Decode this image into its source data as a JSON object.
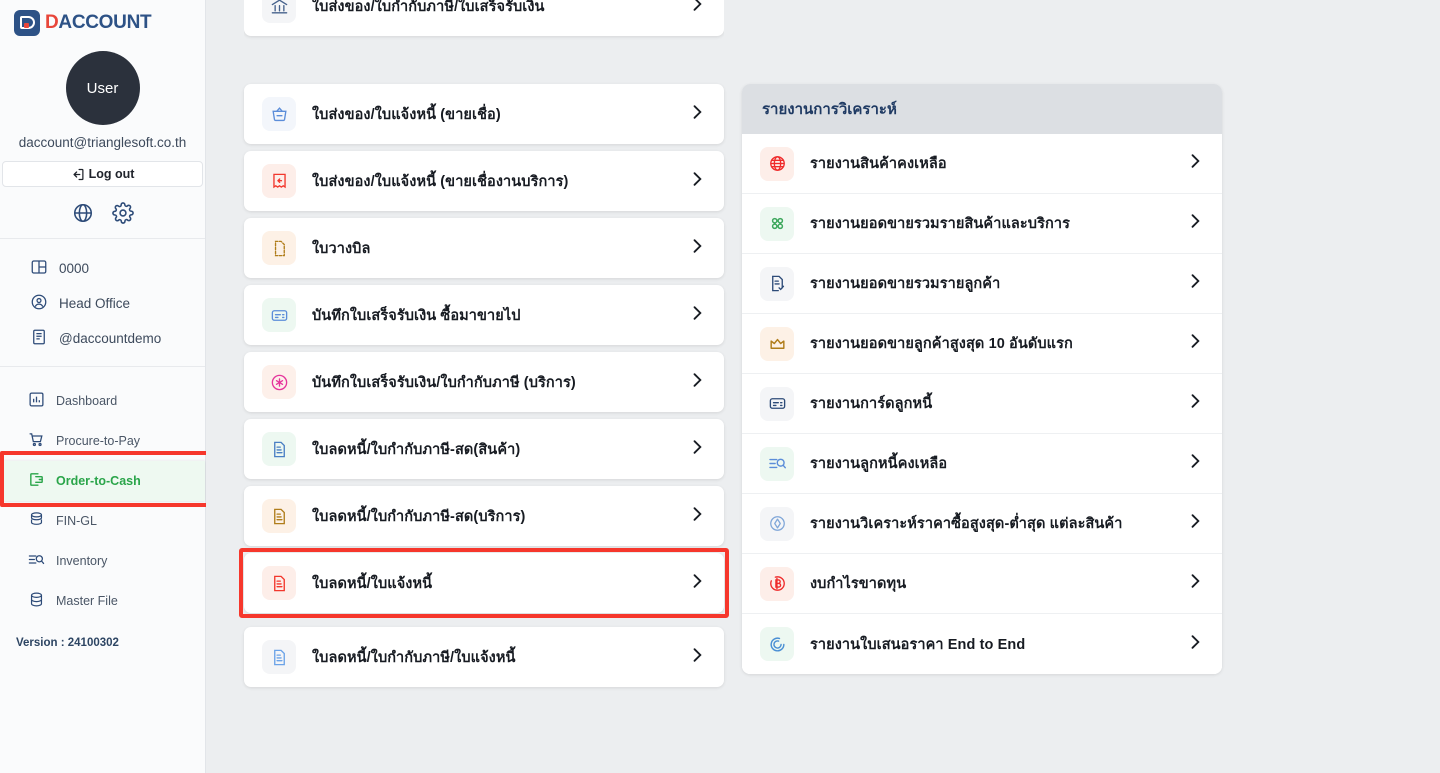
{
  "brand": {
    "name_prefix": "D",
    "name": "ACCOUNT",
    "logo_icon": "daccount-logo-icon"
  },
  "sidebar": {
    "avatar_label": "User",
    "email": "daccount@trianglesoft.co.th",
    "logout_label": "Log out",
    "quick_icons": [
      {
        "name": "globe-icon",
        "label": "Language"
      },
      {
        "name": "gear-icon",
        "label": "Settings"
      }
    ],
    "org_items": [
      {
        "icon": "company-icon",
        "label": "0000"
      },
      {
        "icon": "user-circle-icon",
        "label": "Head Office"
      },
      {
        "icon": "document-icon",
        "label": "@daccountdemo"
      }
    ],
    "nav_items": [
      {
        "icon": "dashboard-icon",
        "label": "Dashboard",
        "active": false
      },
      {
        "icon": "cart-icon",
        "label": "Procure-to-Pay",
        "active": false
      },
      {
        "icon": "order-to-cash-icon",
        "label": "Order-to-Cash",
        "active": true
      },
      {
        "icon": "coins-icon",
        "label": "FIN-GL",
        "active": false
      },
      {
        "icon": "inventory-search-icon",
        "label": "Inventory",
        "active": false
      },
      {
        "icon": "database-icon",
        "label": "Master File",
        "active": false
      }
    ],
    "version_label": "Version : 24100302",
    "highlight_target": "Order-to-Cash",
    "accent_active": "#2aa54a",
    "highlight_color": "#f6372c"
  },
  "documents_panel": {
    "items": [
      {
        "icon": "bank-icon",
        "label": "ใบส่งของ/ใบกำกับภาษี/ใบเสร็จรับเงิน",
        "icon_color": "#46628c",
        "icon_bg": "#f4f5f7",
        "highlighted": false
      },
      {
        "icon": "basket-icon",
        "label": "ใบส่งของ/ใบแจ้งหนี้ (ขายเชื่อ)",
        "icon_color": "#5b8dd9",
        "icon_bg": "#f3f6fb",
        "highlighted": false
      },
      {
        "icon": "receipt-return-icon",
        "label": "ใบส่งของ/ใบแจ้งหนี้ (ขายเชื่องานบริการ)",
        "icon_color": "#f2372c",
        "icon_bg": "#fdeee9",
        "highlighted": false
      },
      {
        "icon": "bill-icon",
        "label": "ใบวางบิล",
        "icon_color": "#b07d1a",
        "icon_bg": "#fdf1e6",
        "highlighted": false
      },
      {
        "icon": "card-note-icon",
        "label": "บันทึกใบเสร็จรับเงิน ซื้อมาขายไป",
        "icon_color": "#5b8dd9",
        "icon_bg": "#edf8f1",
        "highlighted": false
      },
      {
        "icon": "asterisk-circle-icon",
        "label": "บันทึกใบเสร็จรับเงิน/ใบกำกับภาษี (บริการ)",
        "icon_color": "#e5359c",
        "icon_bg": "#fdf0ea",
        "highlighted": false
      },
      {
        "icon": "credit-note-icon",
        "label": "ใบลดหนี้/ใบกำกับภาษี-สด(สินค้า)",
        "icon_color": "#4a7fc4",
        "icon_bg": "#edf8f1",
        "highlighted": false
      },
      {
        "icon": "credit-note-icon",
        "label": "ใบลดหนี้/ใบกำกับภาษี-สด(บริการ)",
        "icon_color": "#b07d1a",
        "icon_bg": "#fdf1e6",
        "highlighted": false
      },
      {
        "icon": "credit-note-icon",
        "label": "ใบลดหนี้/ใบแจ้งหนี้",
        "icon_color": "#f2372c",
        "icon_bg": "#fdeee9",
        "highlighted": true
      },
      {
        "icon": "credit-note-icon",
        "label": "ใบลดหนี้/ใบกำกับภาษี/ใบแจ้งหนี้",
        "icon_color": "#6ba3e8",
        "icon_bg": "#f4f5f7",
        "highlighted": false
      }
    ]
  },
  "reports_panel": {
    "header": "รายงานการวิเคราะห์",
    "items": [
      {
        "icon": "globe-report-icon",
        "label": "รายงานสินค้าคงเหลือ",
        "icon_color": "#ef2b2b",
        "icon_bg": "#fdeee9"
      },
      {
        "icon": "grid-dots-icon",
        "label": "รายงานยอดขายรวมรายสินค้าและบริการ",
        "icon_color": "#3fa85e",
        "icon_bg": "#edf8f1"
      },
      {
        "icon": "doc-check-icon",
        "label": "รายงานยอดขายรวมรายลูกค้า",
        "icon_color": "#2d4b78",
        "icon_bg": "#f4f5f7"
      },
      {
        "icon": "crown-icon",
        "label": "รายงานยอดขายลูกค้าสูงสุด 10 อันดับแรก",
        "icon_color": "#b07d1a",
        "icon_bg": "#fdf1e6"
      },
      {
        "icon": "card-note-icon",
        "label": "รายงานการ์ดลูกหนี้",
        "icon_color": "#2d4b78",
        "icon_bg": "#f4f5f7"
      },
      {
        "icon": "list-search-icon",
        "label": "รายงานลูกหนี้คงเหลือ",
        "icon_color": "#5b8dd9",
        "icon_bg": "#edf8f1"
      },
      {
        "icon": "price-analysis-icon",
        "label": "รายงานวิเคราะห์ราคาซื้อสูงสุด-ต่ำสุด แต่ละสินค้า",
        "icon_color": "#7fa6d8",
        "icon_bg": "#f4f5f7"
      },
      {
        "icon": "baht-circle-icon",
        "label": "งบกำไรขาดทุน",
        "icon_color": "#ef2b2b",
        "icon_bg": "#fdeee9"
      },
      {
        "icon": "target-icon",
        "label": "รายงานใบเสนอราคา End to End",
        "icon_color": "#4a8fd4",
        "icon_bg": "#edf8f1"
      }
    ]
  }
}
